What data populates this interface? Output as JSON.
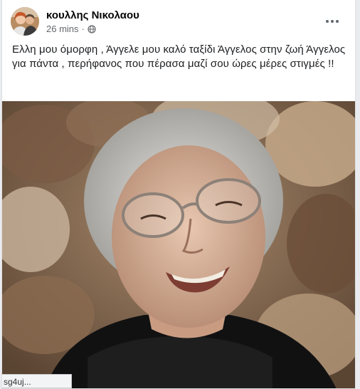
{
  "post": {
    "author": "κουλλης Νικολαου",
    "timestamp": "26 mins",
    "separator": "·",
    "privacy_icon": "globe-icon",
    "menu_icon": "more-horizontal-icon",
    "text": "Ελλη μου όμορφη , Άγγελε μου καλό ταξίδι Άγγελος στην ζωή Άγγελος για πάντα , περήφανος που πέρασα μαζί σου ώρες μέρες στιγμές !!"
  },
  "status_bar": {
    "url": "sg4uj..."
  },
  "colors": {
    "page_bg": "#e9ebee",
    "card_bg": "#ffffff",
    "text": "#1c1e21",
    "meta": "#65676b"
  }
}
